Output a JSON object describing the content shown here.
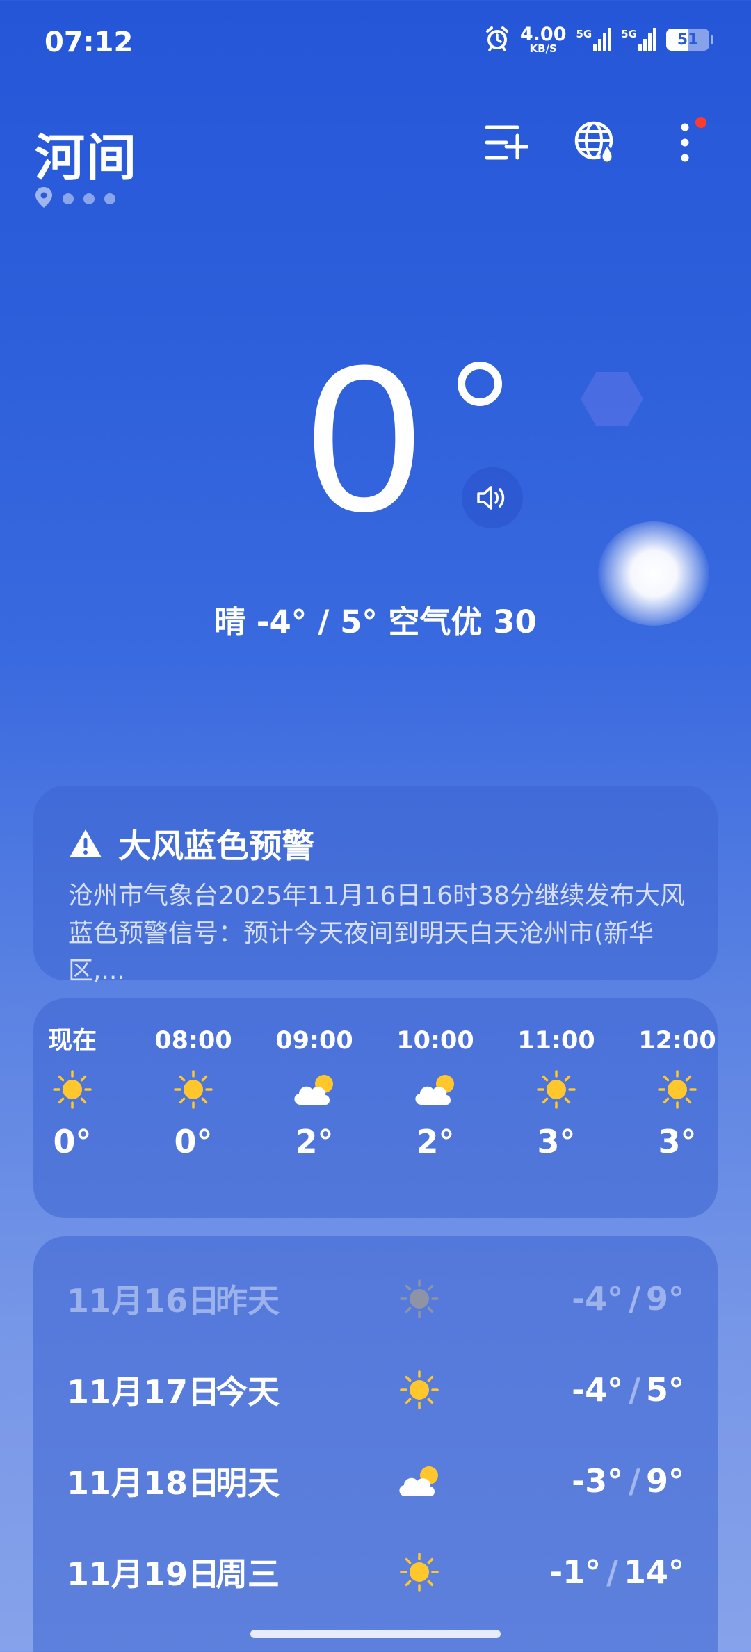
{
  "status_bar": {
    "time": "07:12",
    "net_speed_value": "4.00",
    "net_speed_unit": "KB/S",
    "sim1_label": "5G",
    "sim2_label": "5G",
    "battery": "51"
  },
  "header": {
    "city": "河间",
    "page_count": 4,
    "active_page": 0
  },
  "current": {
    "temperature": "0",
    "summary": "晴  -4° / 5°  空气优 30"
  },
  "alert": {
    "title": "大风蓝色预警",
    "text": "沧州市气象台2025年11月16日16时38分继续发布大风蓝色预警信号：预计今天夜间到明天白天沧州市(新华区,..."
  },
  "hourly": [
    {
      "time": "现在",
      "icon": "sun-icon",
      "temp": "0°"
    },
    {
      "time": "08:00",
      "icon": "sun-icon",
      "temp": "0°"
    },
    {
      "time": "09:00",
      "icon": "partly-cloudy-icon",
      "temp": "2°"
    },
    {
      "time": "10:00",
      "icon": "partly-cloudy-icon",
      "temp": "2°"
    },
    {
      "time": "11:00",
      "icon": "sun-icon",
      "temp": "3°"
    },
    {
      "time": "12:00",
      "icon": "sun-icon",
      "temp": "3°"
    }
  ],
  "daily": [
    {
      "date": "11月16日",
      "weekday": "昨天",
      "icon": "sun-icon",
      "low": "-4°",
      "high": "9°",
      "past": true
    },
    {
      "date": "11月17日",
      "weekday": "今天",
      "icon": "sun-icon",
      "low": "-4°",
      "high": "5°",
      "past": false
    },
    {
      "date": "11月18日",
      "weekday": "明天",
      "icon": "partly-cloudy-icon",
      "low": "-3°",
      "high": "9°",
      "past": false
    },
    {
      "date": "11月19日",
      "weekday": "周三",
      "icon": "sun-icon",
      "low": "-1°",
      "high": "14°",
      "past": false
    }
  ],
  "colors": {
    "sun": "#FFC72C",
    "notification_dot": "#FF3B30",
    "background_top": "#2556D8"
  }
}
